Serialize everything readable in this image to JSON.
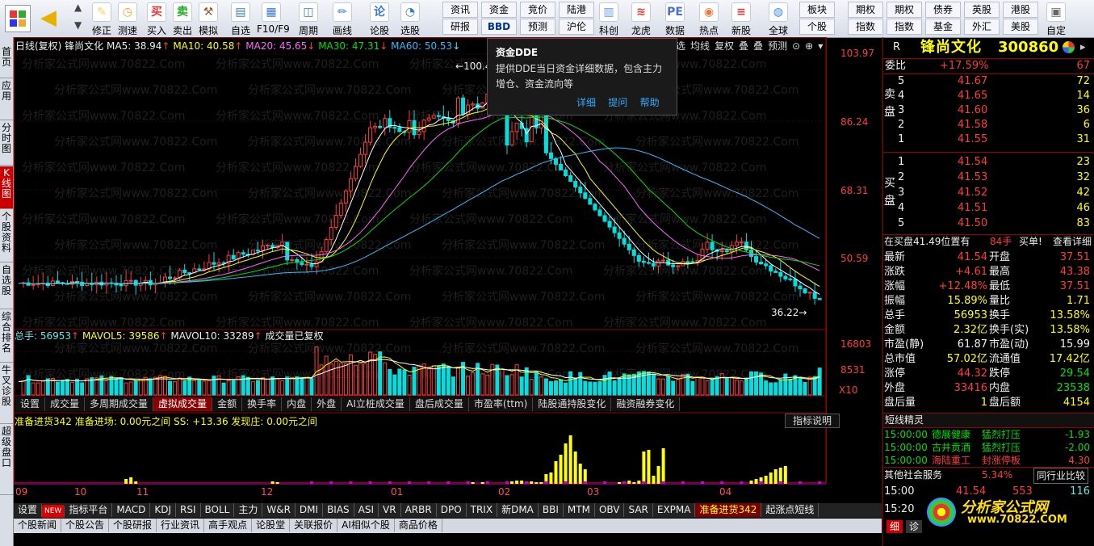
{
  "toolbar": {
    "buttons": [
      {
        "label": "修正",
        "icon": "edit-icon"
      },
      {
        "label": "测速",
        "icon": "clock-icon"
      },
      {
        "label": "买入",
        "icon": "buy-icon"
      },
      {
        "label": "卖出",
        "icon": "sell-icon"
      },
      {
        "label": "模拟",
        "icon": "hammer-icon"
      },
      {
        "label": "自选",
        "icon": "favorites-icon"
      },
      {
        "label": "F10/F9",
        "icon": "f10-icon"
      },
      {
        "label": "周期",
        "icon": "period-icon"
      },
      {
        "label": "画线",
        "icon": "pencil-icon"
      },
      {
        "label": "论股",
        "icon": "discuss-icon"
      },
      {
        "label": "选股",
        "icon": "select-stock-icon"
      },
      {
        "label": "科创",
        "icon": "kechuang-icon"
      },
      {
        "label": "龙虎",
        "icon": "dragon-tiger-icon"
      },
      {
        "label": "数据",
        "icon": "data-icon"
      },
      {
        "label": "热点",
        "icon": "hot-icon"
      },
      {
        "label": "新股",
        "icon": "new-stock-icon"
      },
      {
        "label": "全球",
        "icon": "globe-icon"
      },
      {
        "label": "自定",
        "icon": "custom-icon"
      }
    ],
    "small": [
      [
        "资讯",
        "研报"
      ],
      [
        "资金",
        "BBD"
      ],
      [
        "竞价",
        "预测"
      ],
      [
        "陆港",
        "沪伦"
      ],
      [
        "板块",
        "个股"
      ],
      [
        "期权",
        "指数"
      ],
      [
        "债券",
        "基金"
      ],
      [
        "英股",
        "外汇"
      ],
      [
        "港股",
        "美股"
      ]
    ],
    "small_top": [
      "资讯",
      "资金",
      "竞价",
      "陆港",
      "板块",
      "期权",
      "债券",
      "英股",
      "港股"
    ],
    "small_bot": [
      "研报",
      "BBD",
      "预测",
      "沪伦",
      "个股",
      "指数",
      "基金",
      "外汇",
      "美股"
    ],
    "extra_top": "期权",
    "extra_bot": "指数"
  },
  "left_tabs": [
    "首页",
    "应用",
    "分时图",
    "K线图",
    "个股资料",
    "自选股",
    "综合排名",
    "牛叉诊股",
    "超级盘口"
  ],
  "chart": {
    "ma_line": {
      "prefix": "日线(复权) 锋尚文化",
      "ma5": "MA5: 38.94",
      "ma10": "MA10: 40.58",
      "ma20": "MA20: 45.65",
      "ma30": "MA30: 47.31",
      "ma60": "MA60: 50.53"
    },
    "price_labels": [
      "103.97",
      "86.24",
      "68.31",
      "50.59"
    ],
    "high_label": "100.40",
    "low_label": "36.22",
    "vol_line": {
      "total": "总手: 56953",
      "mavol5": "MAVOL5: 39586",
      "mavol10": "MAVOL10: 33289",
      "note": "成交量已复权"
    },
    "vol_labels": [
      "16803",
      "8531",
      "X10"
    ],
    "sub_tabs": [
      "设置",
      "成交量",
      "多周期成交量",
      "虚拟成交量",
      "金额",
      "换手率",
      "内盘",
      "外盘",
      "AI立桩成交量",
      "盘后成交量",
      "市盈率(ttm)",
      "陆股通持股变化",
      "融资融券变化"
    ],
    "ind_line": "准备进货342  准备进场: 0.00元之间  SS: +13.36  发现庄: 0.00元之间",
    "ind_help": "指标说明",
    "months": [
      "09",
      "10",
      "11",
      "12",
      "01",
      "02",
      "03",
      "04"
    ],
    "top_icons": [
      "选",
      "均线",
      "复权",
      "叠",
      "叠",
      "预测"
    ],
    "watermark": "分析家公式网www.70822.Com"
  },
  "bottom_tabs": [
    "设置",
    "NEW",
    "指标平台",
    "MACD",
    "KDJ",
    "RSI",
    "BOLL",
    "主力",
    "W&R",
    "DMI",
    "BIAS",
    "ASI",
    "VR",
    "ARBR",
    "DPO",
    "TRIX",
    "新DMA",
    "BBI",
    "MTM",
    "OBV",
    "SAR",
    "EXPMA",
    "准备进货342",
    "起涨点短线"
  ],
  "news_tabs": [
    "个股新闻",
    "个股公告",
    "个股研报",
    "行业资讯",
    "高手观点",
    "论股堂",
    "关联报价",
    "AI相似个股",
    "商品价格"
  ],
  "tooltip": {
    "title": "资金DDE",
    "body": "提供DDE当日资金详细数据，包含主力增仓、资金流向等",
    "links": [
      "详细",
      "提问",
      "帮助"
    ]
  },
  "quote": {
    "mark": "R",
    "name": "锋尚文化",
    "code": "300860",
    "weibi_label": "委比",
    "weibi": "+17.59%",
    "weicha": "67",
    "sell": [
      [
        "5",
        "41.67",
        "72"
      ],
      [
        "4",
        "41.65",
        "14"
      ],
      [
        "3",
        "41.60",
        "36"
      ],
      [
        "2",
        "41.58",
        "6"
      ],
      [
        "1",
        "41.55",
        "31"
      ]
    ],
    "buy": [
      [
        "1",
        "41.54",
        "23"
      ],
      [
        "2",
        "41.53",
        "32"
      ],
      [
        "3",
        "41.52",
        "42"
      ],
      [
        "4",
        "41.51",
        "46"
      ],
      [
        "5",
        "41.50",
        "83"
      ]
    ],
    "sell_label": "卖盘",
    "buy_label": "买盘",
    "status": "在买盘41.49位置有",
    "status_qty": "84手",
    "status_act": "买单!",
    "status_link": "查看详细",
    "stats": [
      [
        "最新",
        "41.54",
        "开盘",
        "37.51"
      ],
      [
        "涨跌",
        "+4.61",
        "最高",
        "43.38"
      ],
      [
        "涨幅",
        "+12.48%",
        "最低",
        "37.51"
      ],
      [
        "振幅",
        "15.89%",
        "量比",
        "1.71"
      ],
      [
        "总手",
        "56953",
        "换手",
        "13.58%"
      ],
      [
        "金额",
        "2.32亿",
        "换手(实)",
        "13.58%"
      ],
      [
        "市盈(静)",
        "61.87",
        "市盈(动)",
        "15.99"
      ],
      [
        "总市值",
        "57.02亿",
        "流通值",
        "17.42亿"
      ],
      [
        "涨停",
        "44.32",
        "跌停",
        "29.54"
      ],
      [
        "外盘",
        "33416",
        "内盘",
        "23538"
      ],
      [
        "盘后量",
        "1",
        "盘后额",
        "4154"
      ]
    ],
    "short_title": "短线精灵",
    "short": [
      [
        "15:00:00",
        "德展健康",
        "猛烈打压",
        "-1.93"
      ],
      [
        "15:00:00",
        "古井贡酒",
        "猛烈打压",
        "-2.00"
      ],
      [
        "15:00:00",
        "海陆重工",
        "封涨停板",
        "4.30"
      ]
    ],
    "sector": "其他社会服务",
    "sector_pct": "5.34%",
    "sector_btn": "同行业比较",
    "ticks": [
      [
        "15:00",
        "41.54",
        "553",
        "116"
      ],
      [
        "15:20",
        "",
        "",
        ""
      ]
    ],
    "logo": "分析家公式网",
    "logo_url": "www.70822.COM"
  },
  "colors": {
    "up": "#ff3c3c",
    "down": "#00e0e0",
    "ma5": "#ffffff",
    "ma10": "#ffff00",
    "ma20": "#ff66ff",
    "ma30": "#00e000",
    "ma60": "#33bbff"
  }
}
